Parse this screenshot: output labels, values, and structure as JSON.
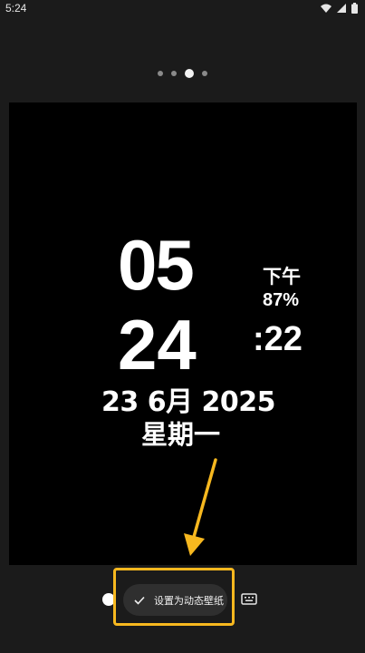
{
  "status_bar": {
    "time": "5:24"
  },
  "pager": {
    "count": 4,
    "active_index": 2
  },
  "preview": {
    "clock_hour": "05",
    "clock_minute": "24",
    "ampm": "下午",
    "battery": "87%",
    "seconds": ":22",
    "date": "23 6月 2025",
    "weekday": "星期一"
  },
  "action": {
    "set_wallpaper_label": "设置为动态壁纸"
  },
  "colors": {
    "highlight": "#f7b81f",
    "background": "#1b1b1b",
    "preview_bg": "#000000"
  }
}
